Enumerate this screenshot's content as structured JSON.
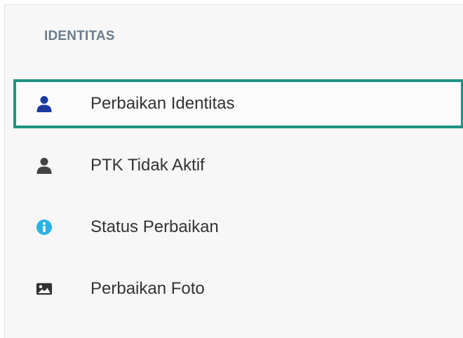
{
  "sidebar": {
    "section_title": "IDENTITAS",
    "items": [
      {
        "label": "Perbaikan Identitas",
        "icon": "user-icon",
        "icon_color": "#1a3a9e",
        "active": true
      },
      {
        "label": "PTK Tidak Aktif",
        "icon": "user-icon",
        "icon_color": "#444444",
        "active": false
      },
      {
        "label": "Status Perbaikan",
        "icon": "info-circle-icon",
        "icon_color": "#2cb1e3",
        "active": false
      },
      {
        "label": "Perbaikan Foto",
        "icon": "image-icon",
        "icon_color": "#333333",
        "active": false
      }
    ]
  },
  "colors": {
    "active_border": "#1e9483",
    "section_title": "#6d7d8c",
    "panel_background": "#f7f7f7"
  }
}
